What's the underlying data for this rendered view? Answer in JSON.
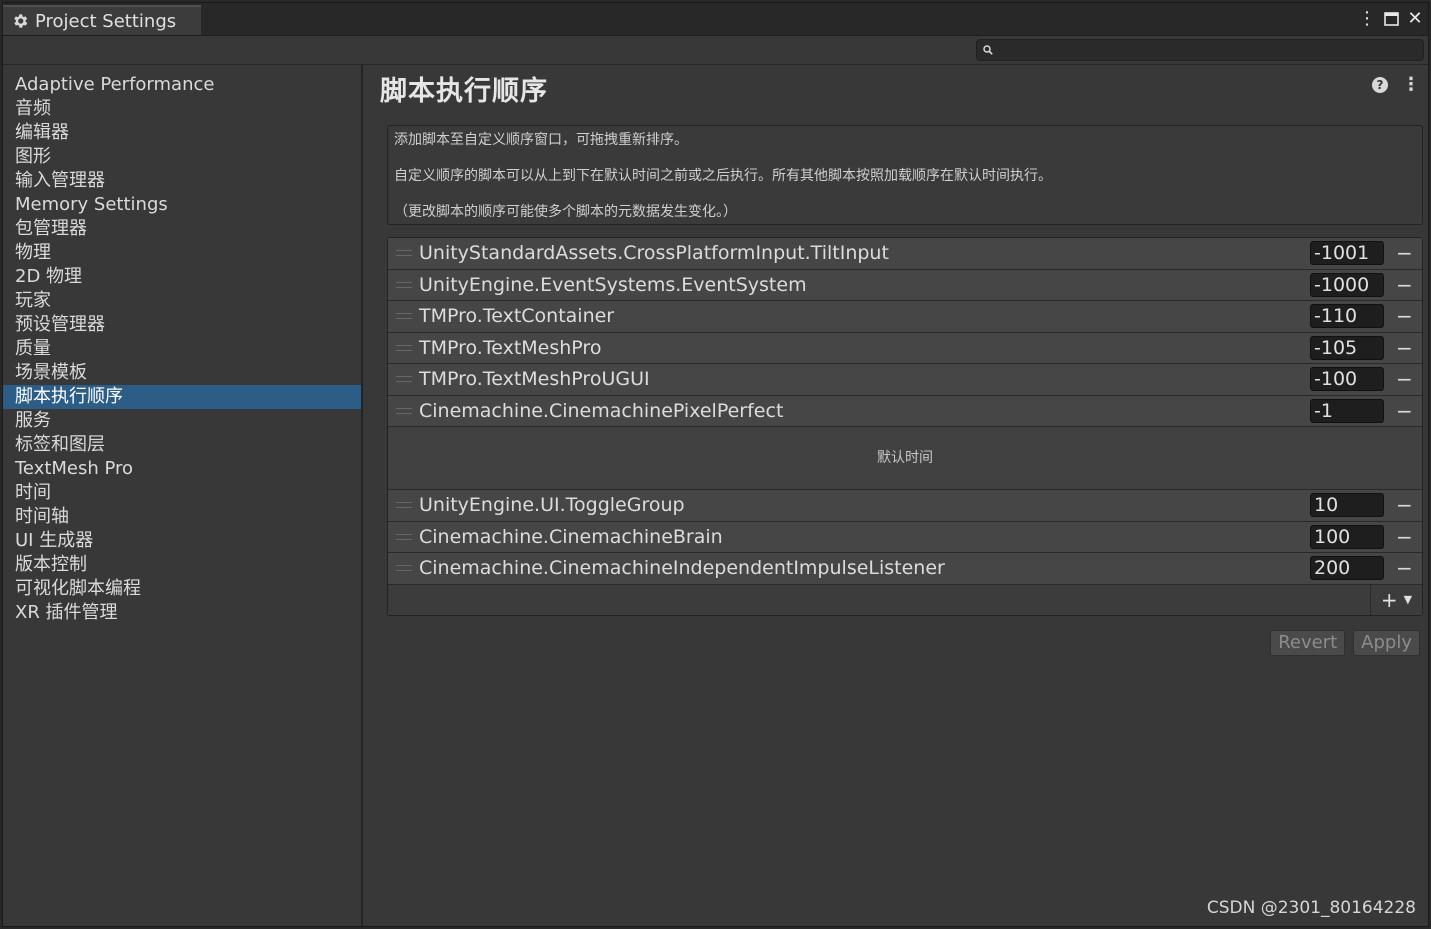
{
  "window": {
    "tab_title": "Project Settings",
    "tab_icon": "gear-icon",
    "controls": [
      "⋮",
      "🗖",
      "✕"
    ]
  },
  "search": {
    "value": "",
    "placeholder": ""
  },
  "sidebar": {
    "items": [
      {
        "label": "Adaptive Performance",
        "active": false
      },
      {
        "label": "音频",
        "active": false
      },
      {
        "label": "编辑器",
        "active": false
      },
      {
        "label": "图形",
        "active": false
      },
      {
        "label": "输入管理器",
        "active": false
      },
      {
        "label": "Memory Settings",
        "active": false
      },
      {
        "label": "包管理器",
        "active": false
      },
      {
        "label": "物理",
        "active": false
      },
      {
        "label": "2D 物理",
        "active": false
      },
      {
        "label": "玩家",
        "active": false
      },
      {
        "label": "预设管理器",
        "active": false
      },
      {
        "label": "质量",
        "active": false
      },
      {
        "label": "场景模板",
        "active": false
      },
      {
        "label": "脚本执行顺序",
        "active": true
      },
      {
        "label": "服务",
        "active": false
      },
      {
        "label": "标签和图层",
        "active": false
      },
      {
        "label": "TextMesh Pro",
        "active": false
      },
      {
        "label": "时间",
        "active": false
      },
      {
        "label": "时间轴",
        "active": false
      },
      {
        "label": "UI 生成器",
        "active": false
      },
      {
        "label": "版本控制",
        "active": false
      },
      {
        "label": "可视化脚本编程",
        "active": false
      },
      {
        "label": "XR 插件管理",
        "active": false
      }
    ]
  },
  "main": {
    "title": "脚本执行顺序",
    "info_lines": [
      "添加脚本至自定义顺序窗口，可拖拽重新排序。",
      "自定义顺序的脚本可以从上到下在默认时间之前或之后执行。所有其他脚本按照加载顺序在默认时间执行。",
      "（更改脚本的顺序可能使多个脚本的元数据发生变化。）"
    ],
    "before_scripts": [
      {
        "name": "UnityStandardAssets.CrossPlatformInput.TiltInput",
        "order": "-1001"
      },
      {
        "name": "UnityEngine.EventSystems.EventSystem",
        "order": "-1000"
      },
      {
        "name": "TMPro.TextContainer",
        "order": "-110"
      },
      {
        "name": "TMPro.TextMeshPro",
        "order": "-105"
      },
      {
        "name": "TMPro.TextMeshProUGUI",
        "order": "-100"
      },
      {
        "name": "Cinemachine.CinemachinePixelPerfect",
        "order": "-1"
      }
    ],
    "default_time_label": "默认时间",
    "after_scripts": [
      {
        "name": "UnityEngine.UI.ToggleGroup",
        "order": "10"
      },
      {
        "name": "Cinemachine.CinemachineBrain",
        "order": "100"
      },
      {
        "name": "Cinemachine.CinemachineIndependentImpulseListener",
        "order": "200"
      }
    ],
    "remove_glyph": "−",
    "add_glyph": "+",
    "add_caret": "▼",
    "revert_label": "Revert",
    "apply_label": "Apply",
    "help_glyph": "?",
    "menu_glyph": "⋮"
  },
  "watermark": "CSDN @2301_80164228",
  "colors": {
    "selection": "#2c5d87",
    "panel": "#383838",
    "row": "#464646"
  }
}
